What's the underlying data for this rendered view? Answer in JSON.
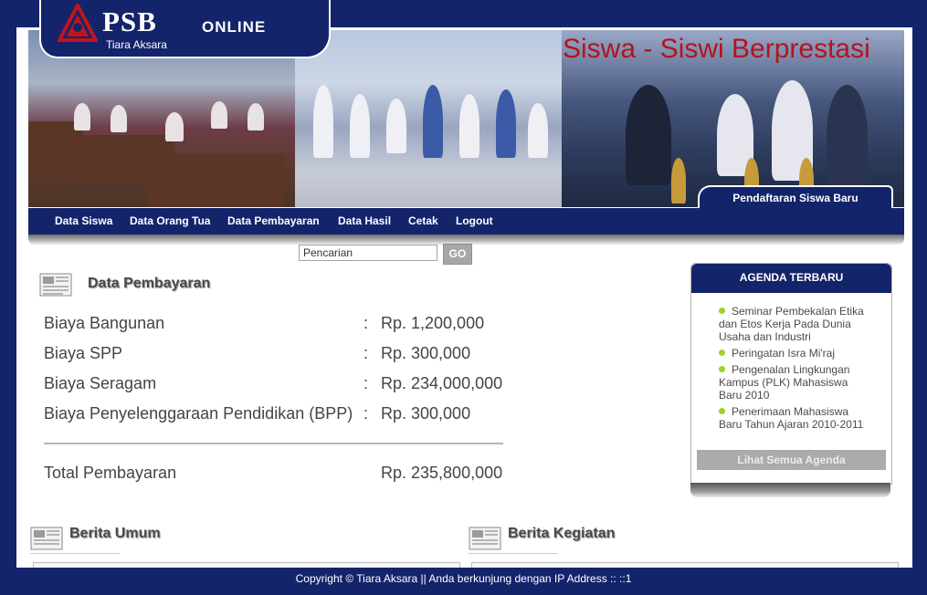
{
  "header": {
    "logo_text": "PSB",
    "logo_online": "ONLINE",
    "logo_subtitle": "Tiara Aksara",
    "banner_title": "Siswa - Siswi Berprestasi",
    "register_tab": "Pendaftaran Siswa Baru"
  },
  "nav": {
    "items": [
      {
        "label": "Data Siswa"
      },
      {
        "label": "Data Orang Tua"
      },
      {
        "label": "Data Pembayaran"
      },
      {
        "label": "Data Hasil"
      },
      {
        "label": "Cetak"
      },
      {
        "label": "Logout"
      }
    ]
  },
  "search": {
    "value": "Pencarian",
    "button_label": "GO"
  },
  "payment": {
    "title": "Data Pembayaran",
    "rows": [
      {
        "label": "Biaya Bangunan",
        "colon": ":",
        "value": "Rp. 1,200,000"
      },
      {
        "label": "Biaya SPP",
        "colon": ":",
        "value": "Rp. 300,000"
      },
      {
        "label": "Biaya Seragam",
        "colon": ":",
        "value": "Rp. 234,000,000"
      },
      {
        "label": "Biaya Penyelenggaraan Pendidikan (BPP)",
        "colon": ":",
        "value": "Rp. 300,000"
      }
    ],
    "total_label": "Total Pembayaran",
    "total_value": "Rp. 235,800,000"
  },
  "agenda": {
    "title": "AGENDA TERBARU",
    "items": [
      {
        "text": "Seminar Pembekalan Etika dan Etos Kerja Pada Dunia Usaha dan Industri"
      },
      {
        "text": "Peringatan Isra Mi'raj"
      },
      {
        "text": "Pengenalan Lingkungan Kampus (PLK) Mahasiswa Baru 2010"
      },
      {
        "text": "Penerimaan Mahasiswa Baru Tahun Ajaran 2010-2011"
      }
    ],
    "more_label": "Lihat Semua Agenda"
  },
  "news": {
    "general_title": "Berita Umum",
    "activity_title": "Berita Kegiatan"
  },
  "footer": {
    "text": "Copyright © Tiara Aksara || Anda berkunjung dengan IP Address :: ::1"
  },
  "colors": {
    "brand_navy": "#14246b",
    "banner_title_red": "#b3141b",
    "bullet_green": "#9fd22a"
  }
}
